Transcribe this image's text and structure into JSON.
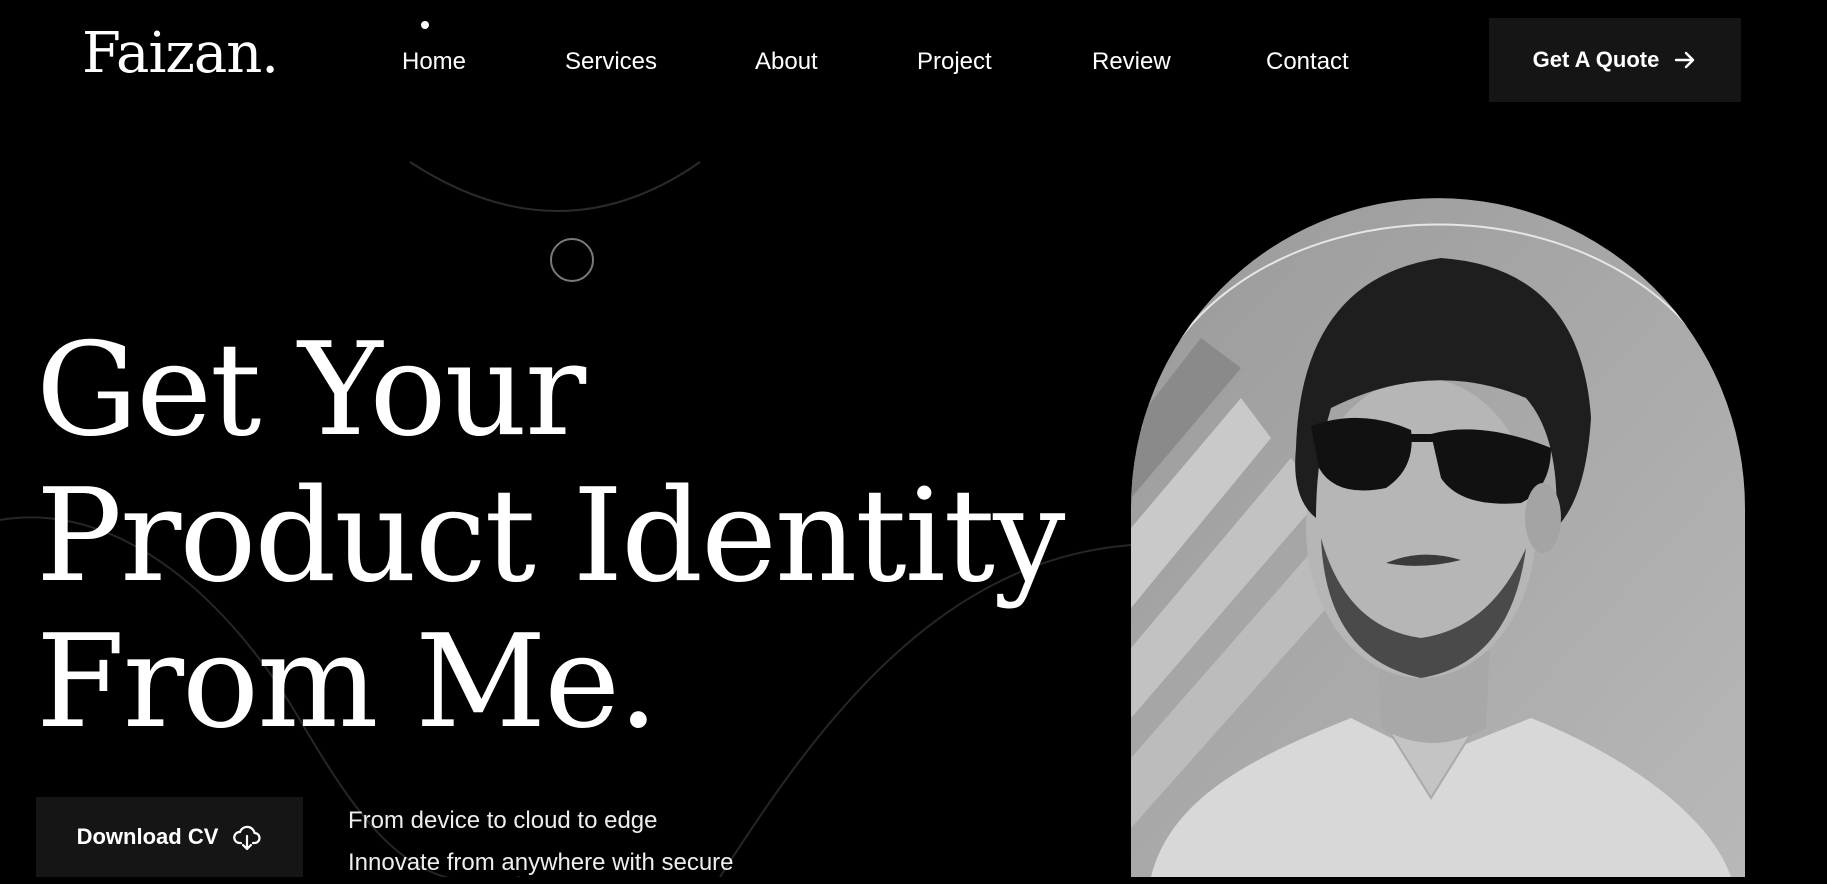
{
  "brand": {
    "logo_text": "Faizan."
  },
  "nav": {
    "items": [
      {
        "label": "Home",
        "active": true
      },
      {
        "label": "Services"
      },
      {
        "label": "About"
      },
      {
        "label": "Project"
      },
      {
        "label": "Review"
      },
      {
        "label": "Contact"
      }
    ]
  },
  "header": {
    "quote_button": {
      "label": "Get A Quote",
      "icon": "arrow-right-icon"
    }
  },
  "hero": {
    "headline_lines": [
      "Get Your",
      "Product Identity",
      "From Me."
    ],
    "cv_button": {
      "label": "Download CV",
      "icon": "cloud-download-icon"
    },
    "description_lines": [
      "From device to cloud to edge",
      "Innovate from anywhere with secure"
    ],
    "portrait": {
      "description_icon": "portrait-image"
    }
  },
  "colors": {
    "background": "#000000",
    "button_bg": "#151515",
    "text": "#ffffff"
  }
}
